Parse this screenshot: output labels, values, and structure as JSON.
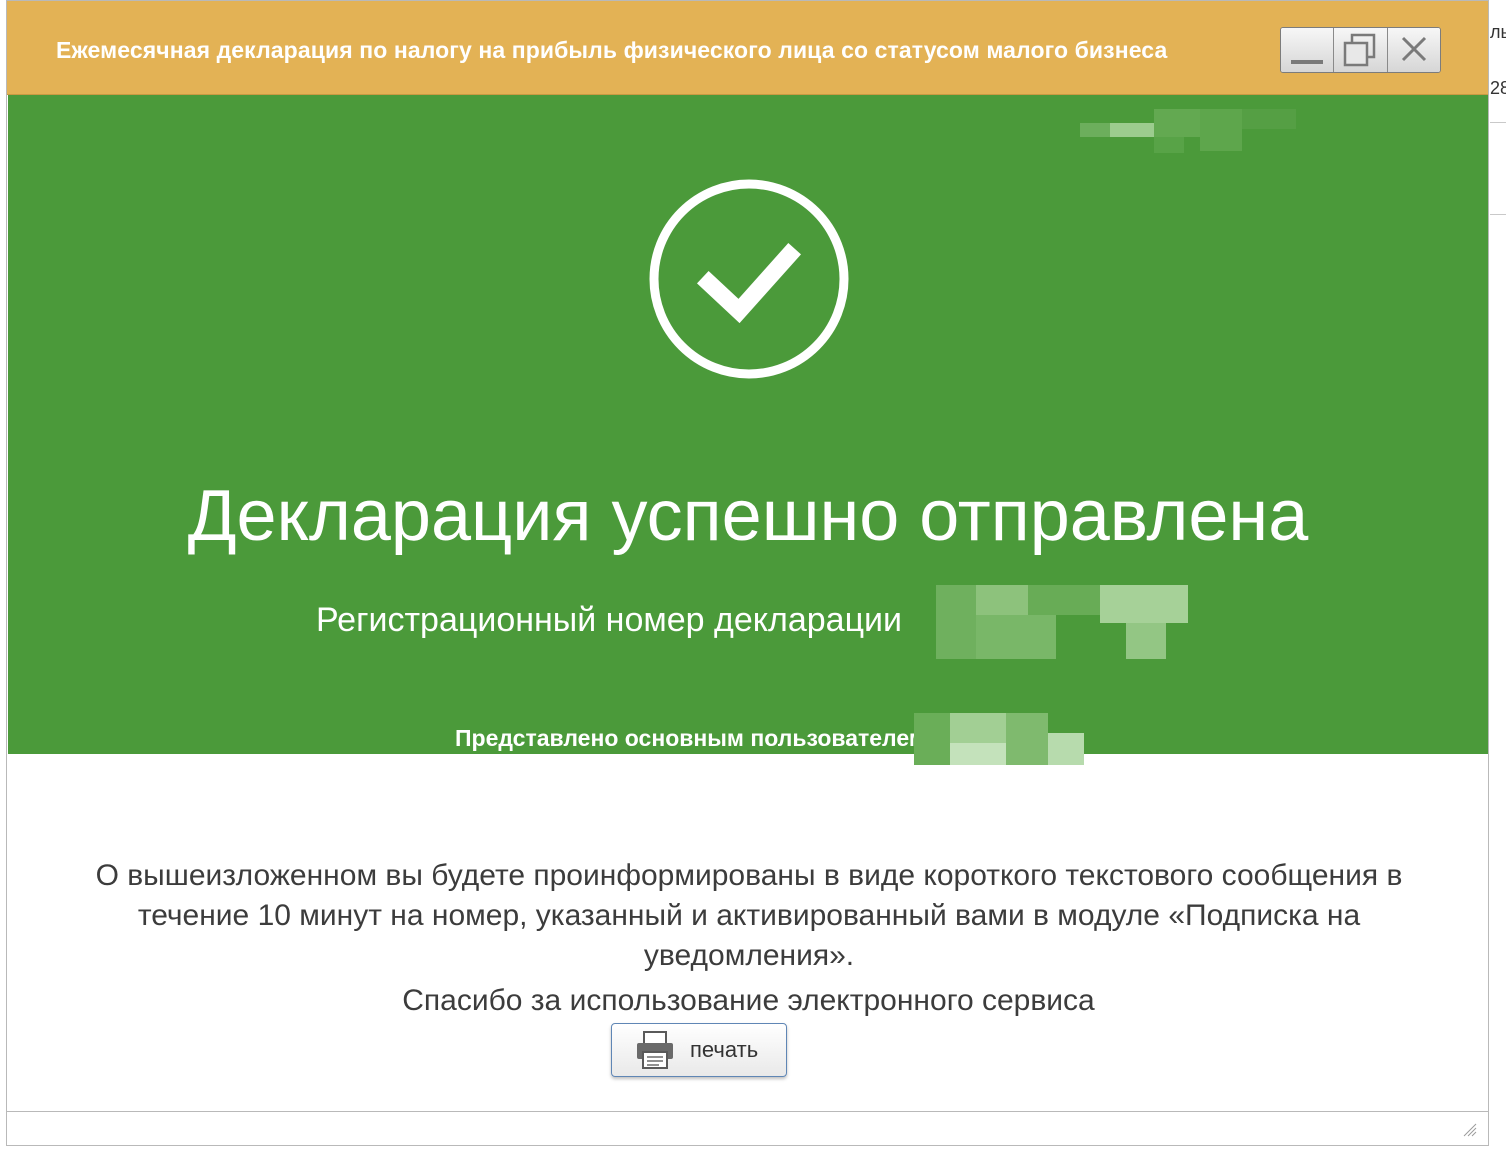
{
  "window": {
    "title": "Ежемесячная декларация по налогу на прибыль физического лица со статусом малого бизнеса",
    "controls": [
      "minimize-icon",
      "maximize-icon",
      "close-icon"
    ]
  },
  "background": {
    "fragment_1": "ль",
    "fragment_2": "28"
  },
  "success": {
    "icon": "check-circle-icon",
    "heading": "Декларация успешно отправлена",
    "registration_label": "Регистрационный номер декларации",
    "submitted_by_label": "Представлено основным пользователем:"
  },
  "notice": {
    "message": "О вышеизложенном вы будете проинформированы в виде короткого текстового сообщения в течение 10 минут на номер, указанный и активированный вами в модуле «Подписка на уведомления».",
    "thanks": "Спасибо за использование электронного сервиса"
  },
  "actions": {
    "print_label": "печать",
    "print_icon": "printer-icon"
  },
  "colors": {
    "titlebar": "#e3b255",
    "success_panel": "#4b9a3a",
    "text_white": "#ffffff",
    "text_dark": "#3c3c3c"
  }
}
